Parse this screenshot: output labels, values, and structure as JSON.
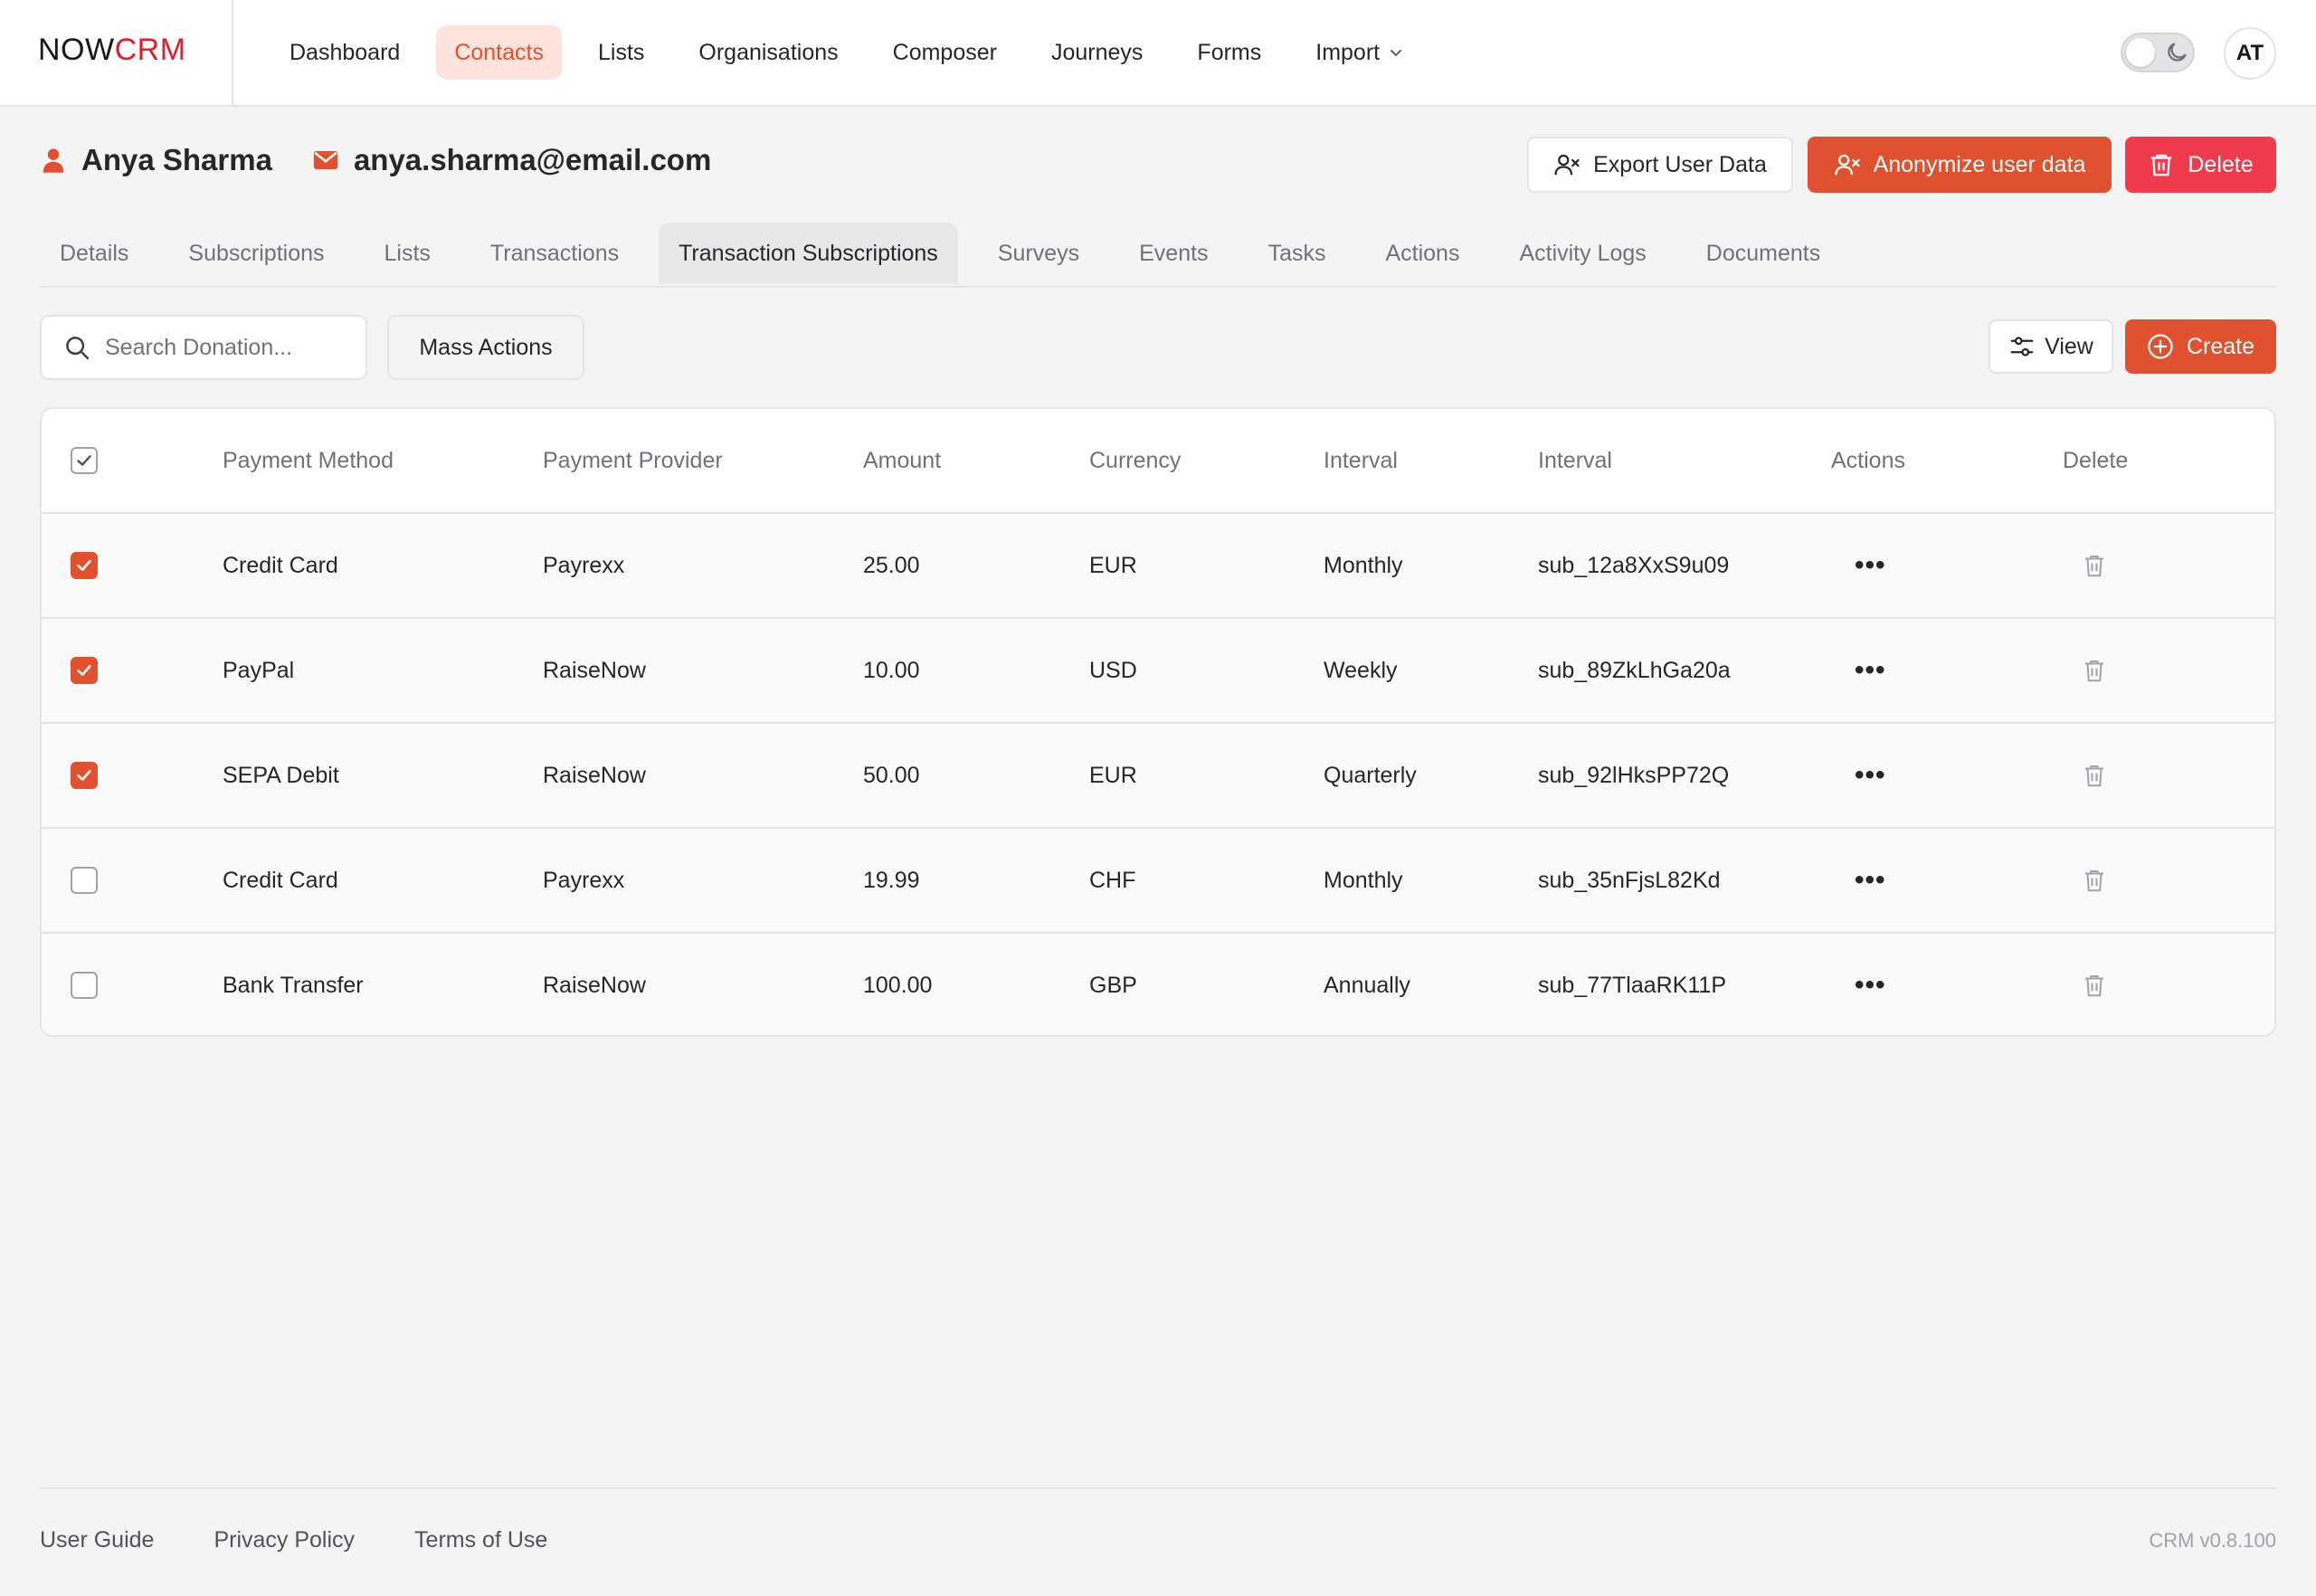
{
  "brand": {
    "part1": "NOW",
    "part2": "CRM"
  },
  "nav": {
    "items": [
      {
        "label": "Dashboard"
      },
      {
        "label": "Contacts"
      },
      {
        "label": "Lists"
      },
      {
        "label": "Organisations"
      },
      {
        "label": "Composer"
      },
      {
        "label": "Journeys"
      },
      {
        "label": "Forms"
      },
      {
        "label": "Import"
      }
    ],
    "active": "Contacts",
    "avatar": "AT"
  },
  "contact": {
    "name": "Anya Sharma",
    "email": "anya.sharma@email.com"
  },
  "header_actions": {
    "export": "Export User Data",
    "anonymize": "Anonymize user data",
    "delete": "Delete"
  },
  "tabs": [
    {
      "label": "Details"
    },
    {
      "label": "Subscriptions"
    },
    {
      "label": "Lists"
    },
    {
      "label": "Transactions"
    },
    {
      "label": "Transaction Subscriptions"
    },
    {
      "label": "Surveys"
    },
    {
      "label": "Events"
    },
    {
      "label": "Tasks"
    },
    {
      "label": "Actions"
    },
    {
      "label": "Activity Logs"
    },
    {
      "label": "Documents"
    }
  ],
  "active_tab": "Transaction Subscriptions",
  "toolbar": {
    "search_placeholder": "Search Donation...",
    "mass_actions": "Mass Actions",
    "view": "View",
    "create": "Create"
  },
  "table": {
    "columns": [
      "Payment Method",
      "Payment Provider",
      "Amount",
      "Currency",
      "Interval",
      "Interval",
      "Actions",
      "Delete"
    ],
    "rows": [
      {
        "checked": true,
        "method": "Credit Card",
        "provider": "Payrexx",
        "amount": "25.00",
        "currency": "EUR",
        "interval": "Monthly",
        "sub_id": "sub_12a8XxS9u09"
      },
      {
        "checked": true,
        "method": "PayPal",
        "provider": "RaiseNow",
        "amount": "10.00",
        "currency": "USD",
        "interval": "Weekly",
        "sub_id": "sub_89ZkLhGa20a"
      },
      {
        "checked": true,
        "method": "SEPA Debit",
        "provider": "RaiseNow",
        "amount": "50.00",
        "currency": "EUR",
        "interval": "Quarterly",
        "sub_id": "sub_92lHksPP72Q"
      },
      {
        "checked": false,
        "method": "Credit Card",
        "provider": "Payrexx",
        "amount": "19.99",
        "currency": "CHF",
        "interval": "Monthly",
        "sub_id": "sub_35nFjsL82Kd"
      },
      {
        "checked": false,
        "method": "Bank Transfer",
        "provider": "RaiseNow",
        "amount": "100.00",
        "currency": "GBP",
        "interval": "Annually",
        "sub_id": "sub_77TlaaRK11P"
      }
    ],
    "actions_glyph": "•••"
  },
  "footer": {
    "links": [
      "User Guide",
      "Privacy Policy",
      "Terms of Use"
    ],
    "version": "CRM v0.8.100"
  },
  "colors": {
    "accent": "#e0522f",
    "danger": "#ef3b4b",
    "brand_red": "#e11d2a"
  }
}
